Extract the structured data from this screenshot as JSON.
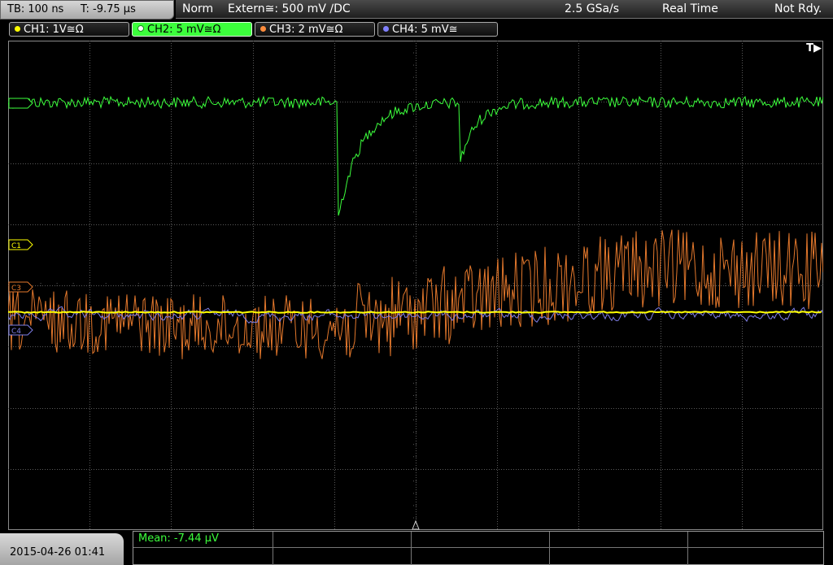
{
  "timebase": {
    "tb_label": "TB: 100 ns",
    "trigger_time": "T: -9.75 µs"
  },
  "status": {
    "mode": "Norm",
    "trigger_source": "Extern≅: 500 mV ∕DC",
    "sample_rate": "2.5 GSa/s",
    "acq_mode": "Real Time",
    "state": "Not Rdy."
  },
  "channels": [
    {
      "label": "CH1: 1V≅Ω",
      "color": "#ffff00",
      "active": false
    },
    {
      "label": "CH2: 5 mV≅Ω",
      "color": "#3cff3c",
      "active": true
    },
    {
      "label": "CH3: 2 mV≅Ω",
      "color": "#ff8c3c",
      "active": false
    },
    {
      "label": "CH4: 5 mV≅",
      "color": "#8080ff",
      "active": false
    }
  ],
  "markers": {
    "c1": "C1",
    "c3": "C3",
    "c4": "C4",
    "trigger": "T▶"
  },
  "measurement": {
    "mean": "Mean: -7.44 µV"
  },
  "datetime": "2015-04-26 01:41",
  "colors": {
    "grid": "#5a5a5a",
    "ch1": "#ffff00",
    "ch2": "#3cff3c",
    "ch3": "#e4782c",
    "ch4": "#7f7fe8"
  }
}
